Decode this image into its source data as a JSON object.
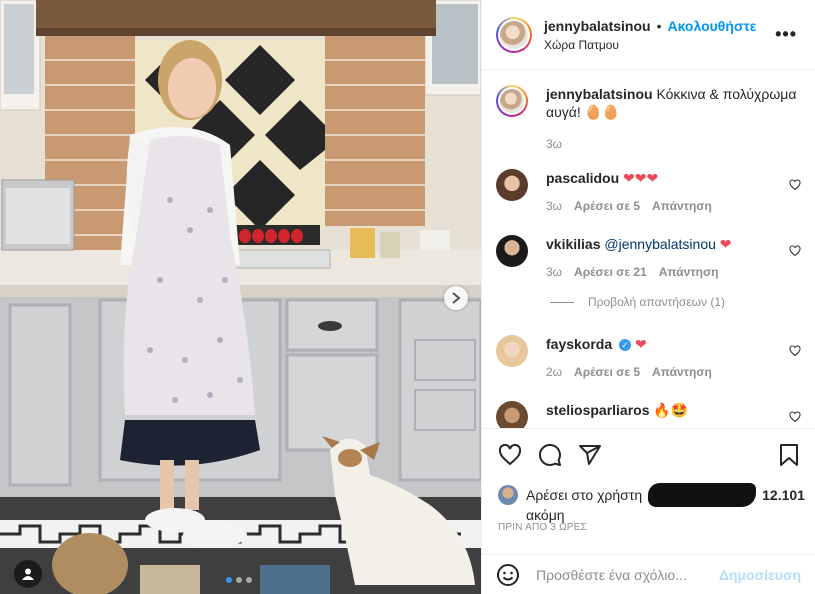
{
  "colors": {
    "accent": "#0095f6",
    "like_red": "#ed4956",
    "muted": "#8e8e8e"
  },
  "post": {
    "author": "jennybalatsinou",
    "follow_label": "Ακολουθήστε",
    "location": "Χώρα Πατμου",
    "caption": "Κόκκινα & πολύχρωμα αυγά! 🥚🥚",
    "caption_time": "3ω",
    "more_icon": "more-horizontal-icon"
  },
  "comments": [
    {
      "user": "pascalidou",
      "text": "❤❤❤",
      "time": "3ω",
      "likes": "Αρέσει σε 5",
      "reply": "Απάντηση"
    },
    {
      "user": "vkikilias",
      "mention": "@jennybalatsinou",
      "text": "❤",
      "time": "3ω",
      "likes": "Αρέσει σε 21",
      "reply": "Απάντηση"
    },
    {
      "user": "fayskorda",
      "verified": true,
      "text": "❤",
      "time": "2ω",
      "likes": "Αρέσει σε 5",
      "reply": "Απάντηση"
    },
    {
      "user": "steliosparliaros",
      "text": "🔥🤩"
    }
  ],
  "view_replies": "Προβολή απαντήσεων (1)",
  "likes_line": {
    "prefix": "Αρέσει στο χρήστη",
    "and_others": "12.101",
    "suffix": "ακόμη"
  },
  "posted_time": "ΠΡΙΝ ΑΠΟ 3 ΩΡΕΣ",
  "composer": {
    "placeholder": "Προσθέστε ένα σχόλιο...",
    "post_label": "Δημοσίευση"
  },
  "carousel": {
    "current": 1,
    "count": 3
  }
}
